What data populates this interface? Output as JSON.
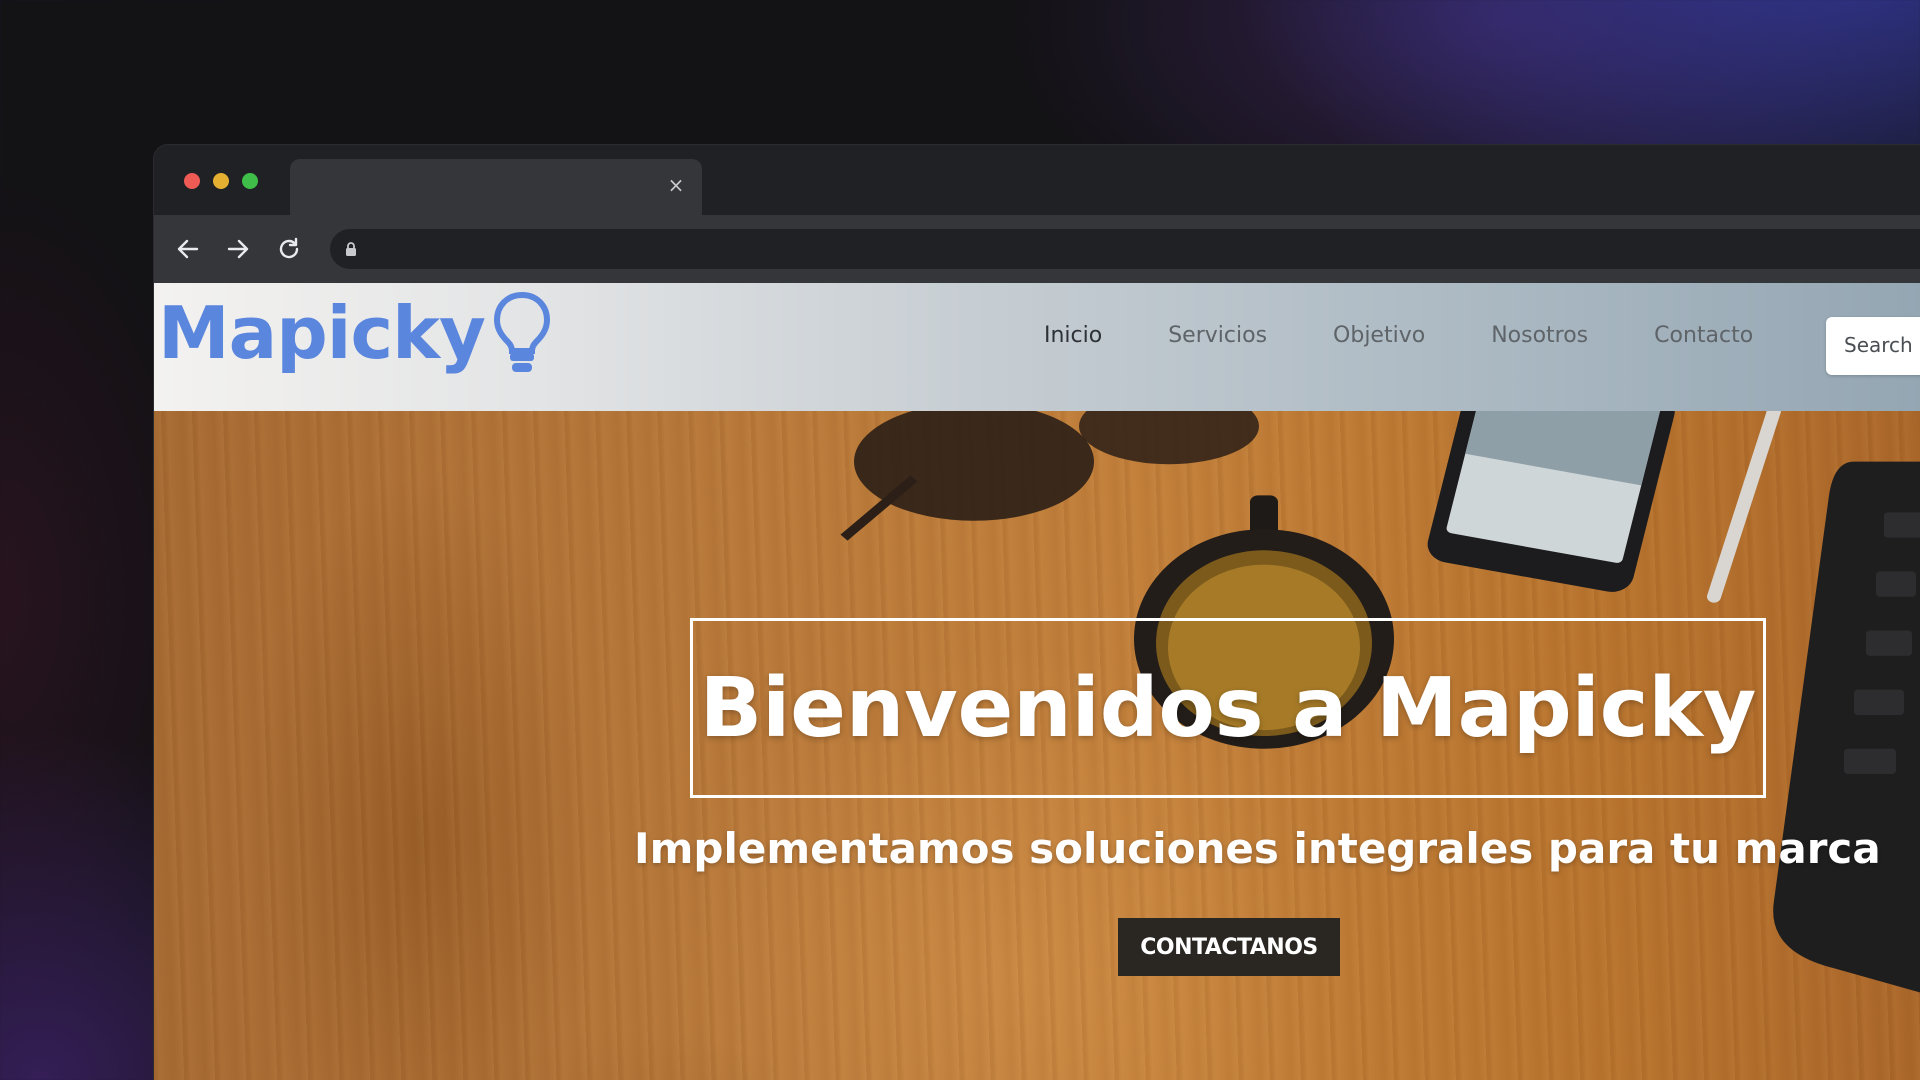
{
  "browser": {
    "tab": {
      "title": ""
    },
    "url": ""
  },
  "site": {
    "logo_text": "Mapicky",
    "nav": [
      {
        "label": "Inicio",
        "active": true
      },
      {
        "label": "Servicios",
        "active": false
      },
      {
        "label": "Objetivo",
        "active": false
      },
      {
        "label": "Nosotros",
        "active": false
      },
      {
        "label": "Contacto",
        "active": false
      }
    ],
    "search": {
      "placeholder": "Search"
    },
    "hero": {
      "title": "Bienvenidos a Mapicky",
      "subtitle": "Implementamos soluciones integrales para tu marca",
      "cta_label": "CONTACTANOS"
    }
  },
  "colors": {
    "logo": "#5b86de",
    "cta_background": "#2a2622",
    "traffic_red": "#ee5b55",
    "traffic_yellow": "#e5b032",
    "traffic_green": "#3fbf4a"
  },
  "icons": {
    "tab_close": "close-icon",
    "back": "arrow-left-icon",
    "forward": "arrow-right-icon",
    "reload": "reload-icon",
    "lock": "lock-icon",
    "logo": "lightbulb-icon"
  }
}
